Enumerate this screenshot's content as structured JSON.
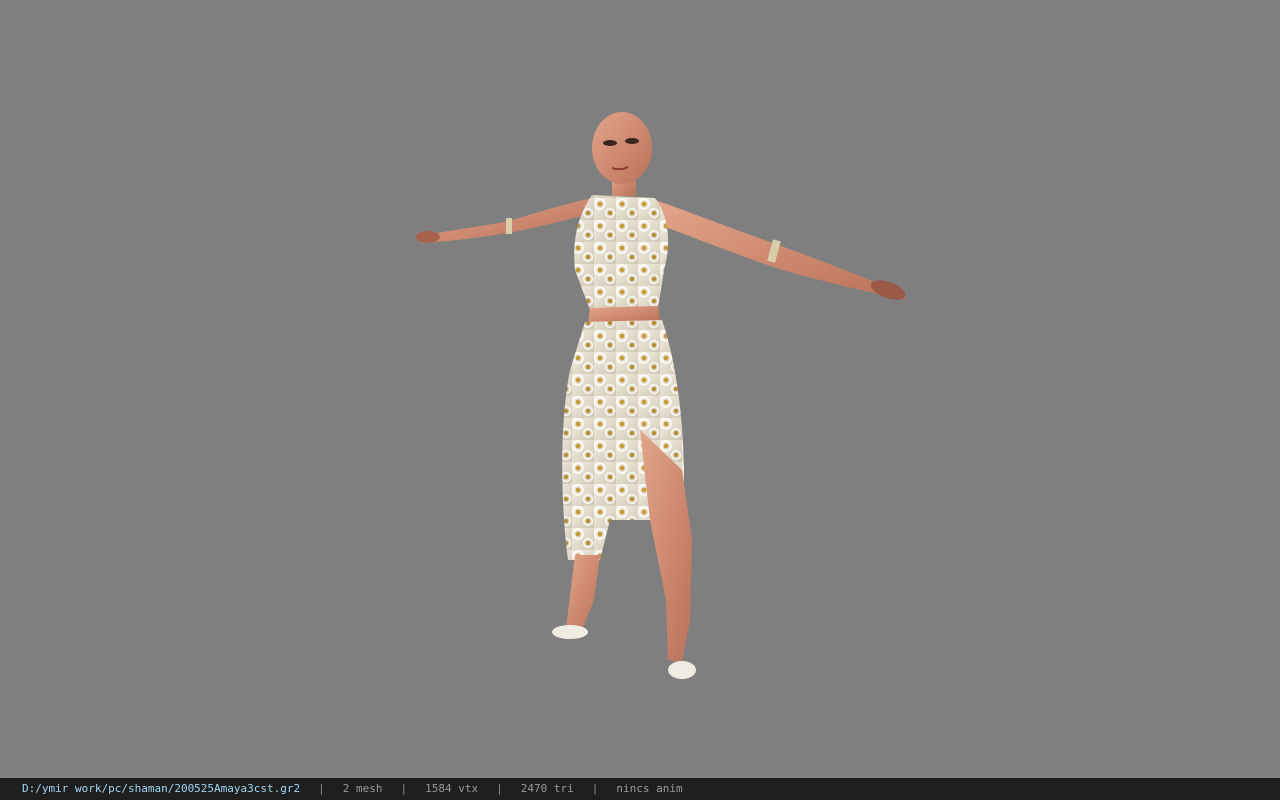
{
  "viewer": {
    "background_color": "#7f7f7f",
    "model_icon": "character-model"
  },
  "statusbar": {
    "file_path": "D:/ymir work/pc/shaman/200525Amaya3cst.gr2",
    "separator": "|",
    "mesh": "2 mesh",
    "vertices": "1584 vtx",
    "triangles": "2470 tri",
    "animation": "nincs anim",
    "path_color": "#9fd6f5"
  }
}
